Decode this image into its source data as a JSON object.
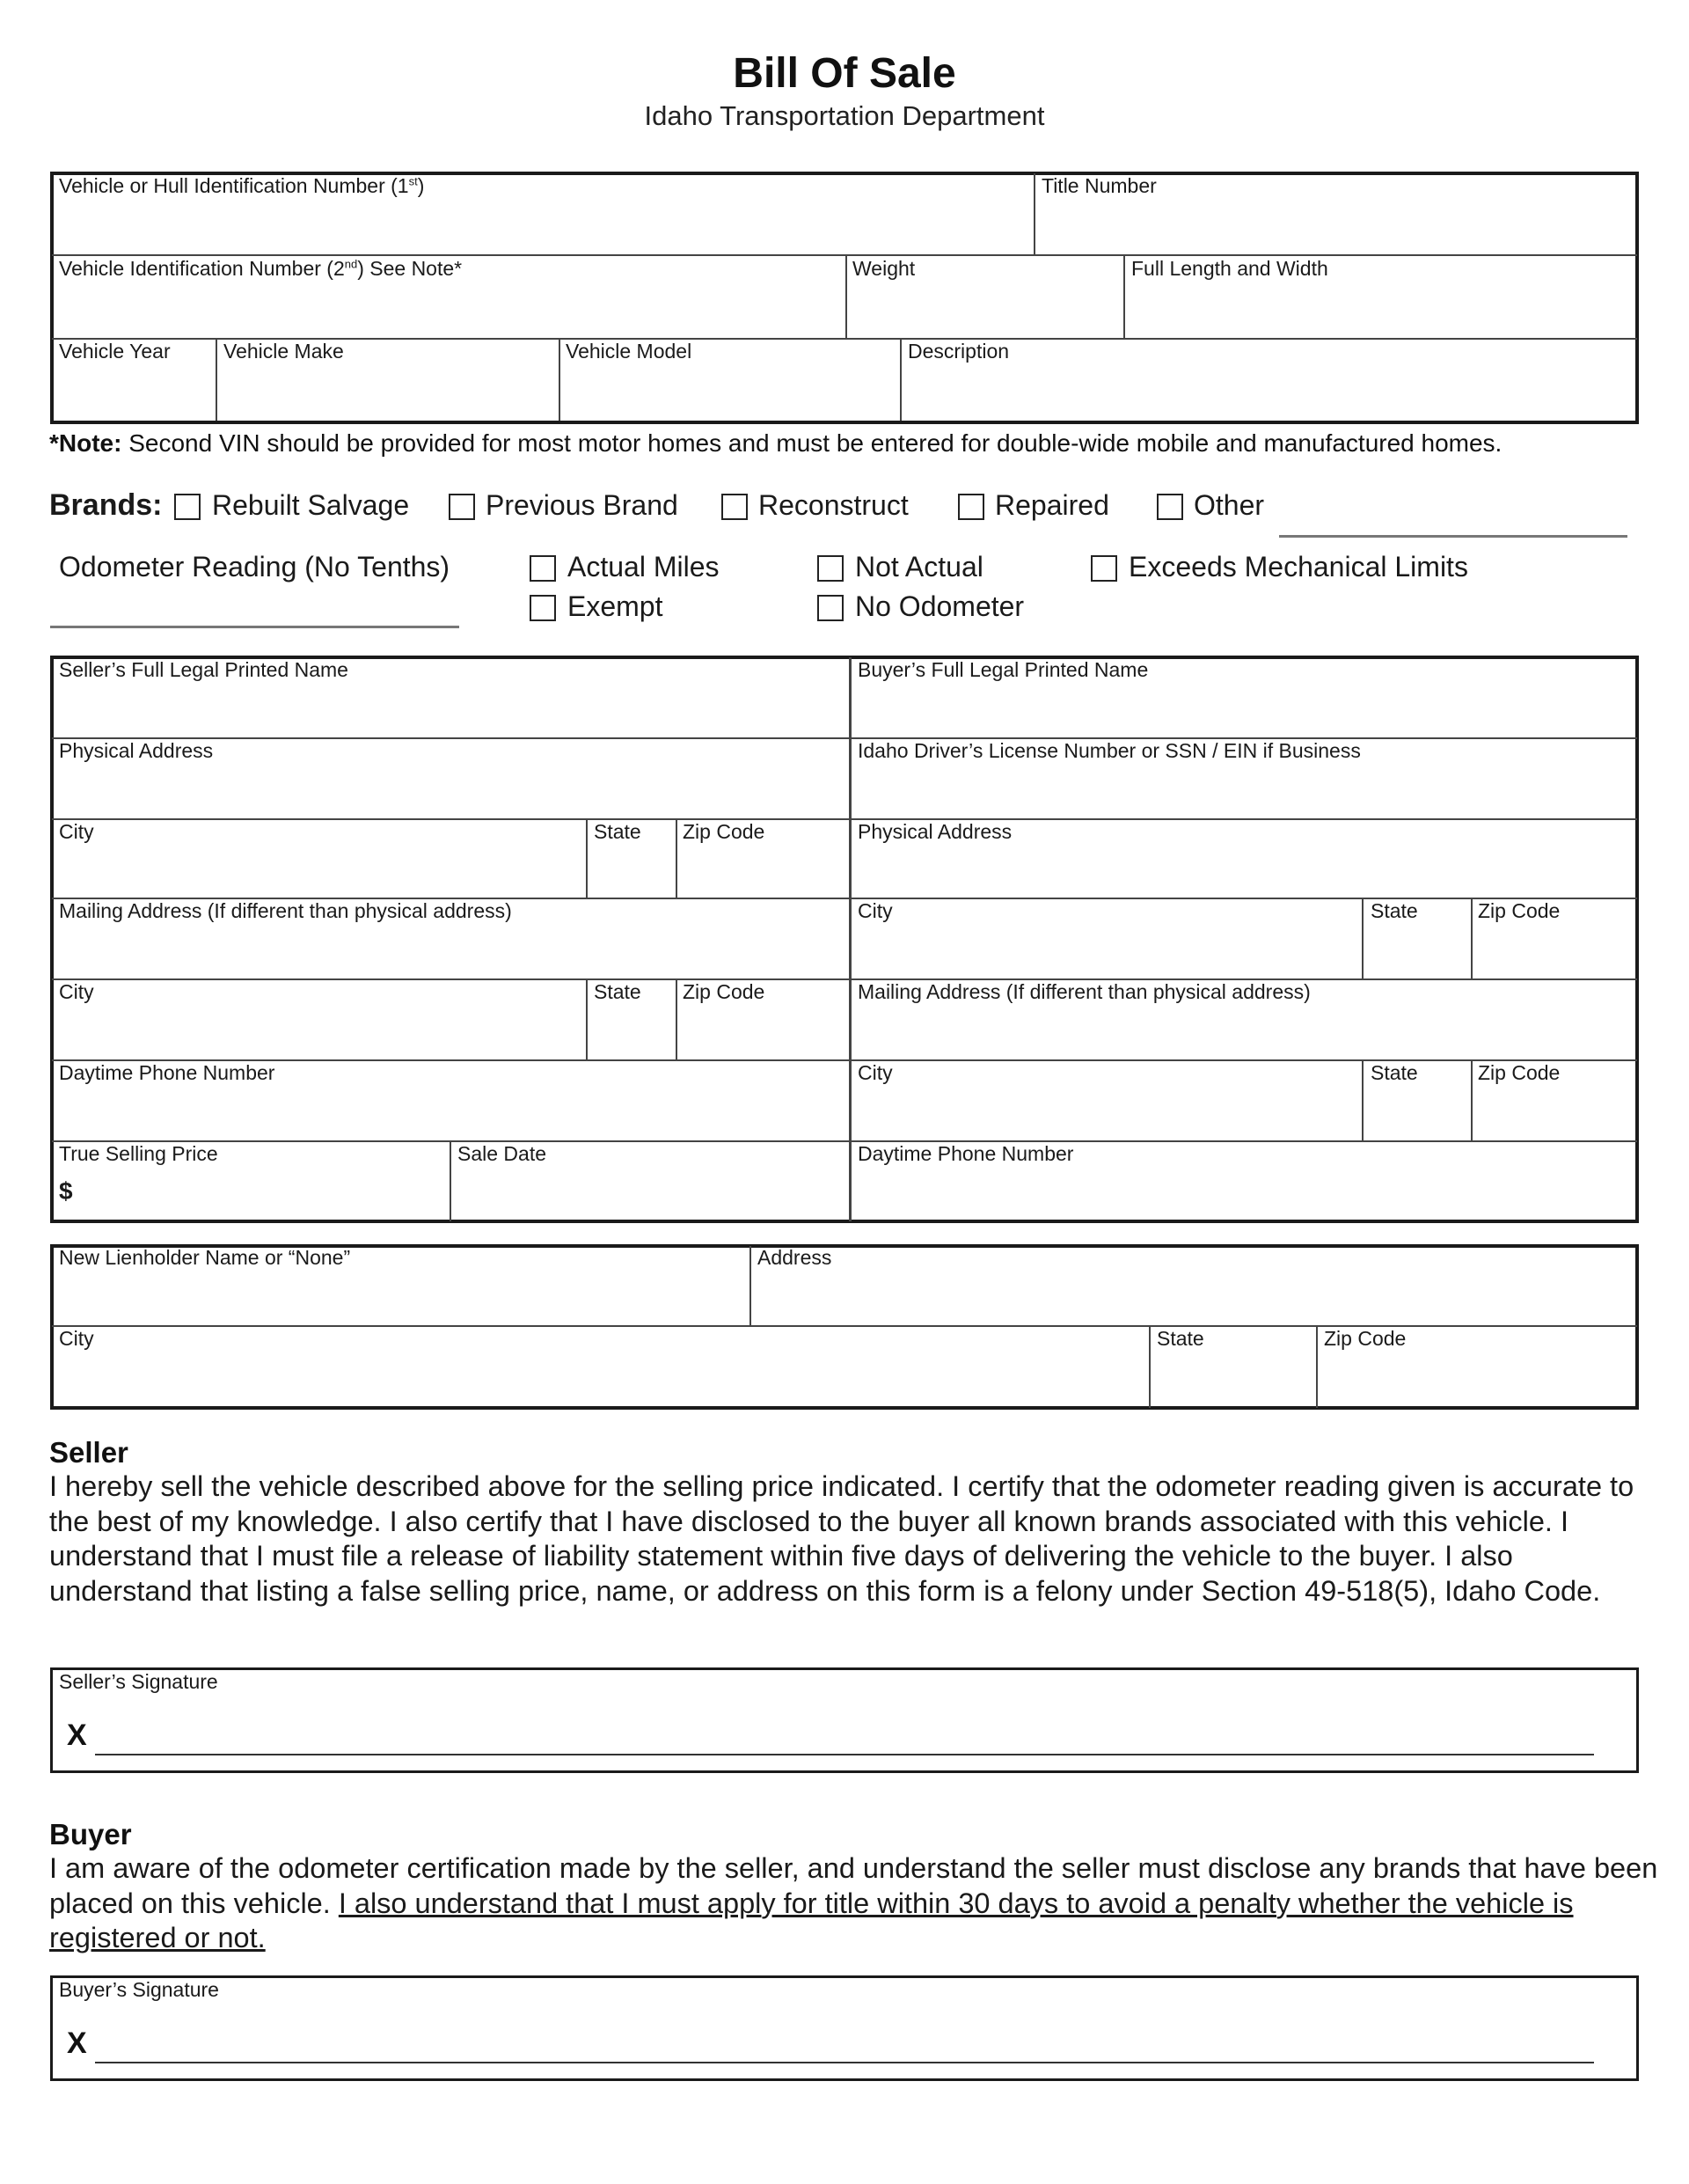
{
  "header": {
    "title": "Bill Of Sale",
    "subtitle": "Idaho Transportation Department"
  },
  "vehicle": {
    "vin1_label": "Vehicle or Hull Identification Number (1",
    "vin1_sup": "st",
    "vin1_suffix": ")",
    "title_number_label": "Title Number",
    "vin2_label": "Vehicle Identification Number (2",
    "vin2_sup": "nd",
    "vin2_suffix": ") See Note*",
    "weight_label": "Weight",
    "length_width_label": "Full Length and Width",
    "year_label": "Vehicle Year",
    "make_label": "Vehicle Make",
    "model_label": "Vehicle Model",
    "description_label": "Description"
  },
  "note": {
    "asterisk": "*",
    "bold": "Note:",
    "text": " Second VIN should be provided for most motor homes and must be entered for double-wide mobile and manufactured homes."
  },
  "brands": {
    "label": "Brands:",
    "options": [
      {
        "label": "Rebuilt Salvage",
        "checked": false
      },
      {
        "label": "Previous Brand",
        "checked": false
      },
      {
        "label": "Reconstruct",
        "checked": false
      },
      {
        "label": "Repaired",
        "checked": false
      },
      {
        "label": "Other",
        "checked": false
      }
    ],
    "other_value": ""
  },
  "odometer": {
    "label": "Odometer Reading (No Tenths)",
    "value": "",
    "options": [
      {
        "label": "Actual Miles",
        "checked": false
      },
      {
        "label": "Not Actual",
        "checked": false
      },
      {
        "label": "Exceeds Mechanical Limits",
        "checked": false
      },
      {
        "label": "Exempt",
        "checked": false
      },
      {
        "label": "No Odometer",
        "checked": false
      }
    ]
  },
  "seller": {
    "name_label": "Seller’s Full Legal Printed Name",
    "physical_address_label": "Physical Address",
    "city_label": "City",
    "state_label": "State",
    "zip_label": "Zip Code",
    "mailing_address_label": "Mailing Address (If different than physical address)",
    "mailing_city_label": "City",
    "mailing_state_label": "State",
    "mailing_zip_label": "Zip Code",
    "phone_label": "Daytime Phone Number",
    "price_label": "True Selling Price",
    "price_symbol": "$",
    "sale_date_label": "Sale Date"
  },
  "buyer": {
    "name_label": "Buyer’s Full Legal Printed Name",
    "license_label": "Idaho Driver’s License Number or SSN / EIN if Business",
    "physical_address_label": "Physical Address",
    "city_label": "City",
    "state_label": "State",
    "zip_label": "Zip Code",
    "mailing_address_label": "Mailing Address (If different than physical address)",
    "mailing_city_label": "City",
    "mailing_state_label": "State",
    "mailing_zip_label": "Zip Code",
    "phone_label": "Daytime Phone Number"
  },
  "lienholder": {
    "name_label": "New Lienholder Name or “None”",
    "address_label": "Address",
    "city_label": "City",
    "state_label": "State",
    "zip_label": "Zip Code"
  },
  "seller_statement": {
    "heading": "Seller",
    "text": "I hereby sell the vehicle described above for the selling price indicated.  I certify that the odometer reading given is accurate to the best of my knowledge.  I also certify that I have disclosed to the buyer all known brands associated with this vehicle.  I understand that I must file a release of liability statement within five days of delivering the vehicle to the buyer.  I also understand that listing a false selling price, name, or address on this form is a felony under Section 49-518(5), Idaho Code.",
    "signature_label": "Seller’s Signature",
    "signature_mark": "X"
  },
  "buyer_statement": {
    "heading": "Buyer",
    "text": "I am aware of the odometer certification made by the seller, and understand the seller must disclose any brands that have been placed on this vehicle.  ",
    "underlined_text": "I also understand that I must apply for title within 30 days to avoid a penalty whether the vehicle is registered or not.",
    "signature_label": "Buyer’s Signature",
    "signature_mark": "X"
  }
}
